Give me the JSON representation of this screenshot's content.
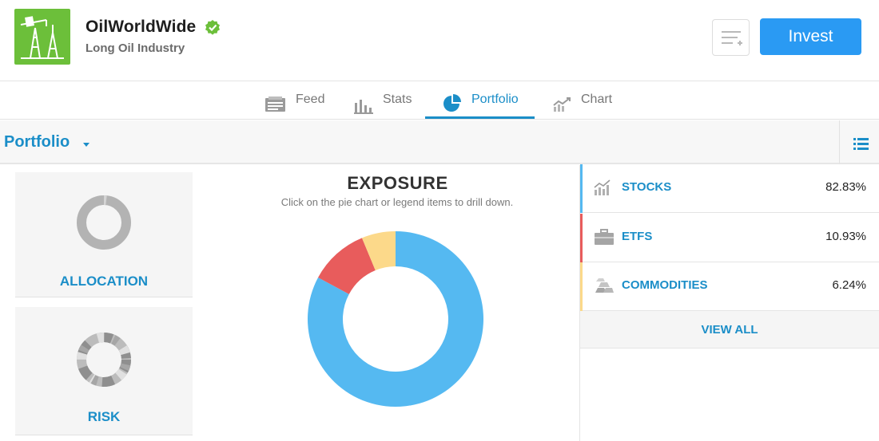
{
  "header": {
    "title": "OilWorldWide",
    "subtitle": "Long Oil Industry",
    "invest_label": "Invest"
  },
  "tabs": [
    {
      "label": "Feed",
      "icon": "feed-icon"
    },
    {
      "label": "Stats",
      "icon": "stats-icon"
    },
    {
      "label": "Portfolio",
      "icon": "pie-icon",
      "active": true
    },
    {
      "label": "Chart",
      "icon": "chart-icon"
    }
  ],
  "section": {
    "title": "Portfolio"
  },
  "cards": [
    {
      "label": "ALLOCATION"
    },
    {
      "label": "RISK"
    }
  ],
  "exposure": {
    "title": "EXPOSURE",
    "subtitle": "Click on the pie chart or legend items to drill down."
  },
  "legend": [
    {
      "label": "STOCKS",
      "value": "82.83%",
      "color": "#55b9f1",
      "icon": "stocks-chart-icon"
    },
    {
      "label": "ETFS",
      "value": "10.93%",
      "color": "#e85c5c",
      "icon": "briefcase-icon"
    },
    {
      "label": "COMMODITIES",
      "value": "6.24%",
      "color": "#fcd98a",
      "icon": "gold-bars-icon"
    }
  ],
  "view_all_label": "VIEW ALL",
  "colors": {
    "accent": "#1b8ec8",
    "invest": "#2a9af3",
    "logo": "#6cbf3a"
  },
  "chart_data": {
    "type": "pie",
    "categories": [
      "STOCKS",
      "ETFS",
      "COMMODITIES"
    ],
    "values": [
      82.83,
      10.93,
      6.24
    ],
    "colors": [
      "#55b9f1",
      "#e85c5c",
      "#fcd98a"
    ],
    "title": "EXPOSURE"
  }
}
